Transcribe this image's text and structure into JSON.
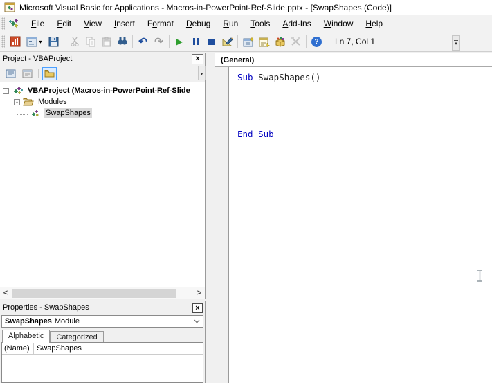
{
  "title_bar": {
    "title": "Microsoft Visual Basic for Applications - Macros-in-PowerPoint-Ref-Slide.pptx - [SwapShapes (Code)]"
  },
  "menu_bar": {
    "items": [
      "File",
      "Edit",
      "View",
      "Insert",
      "Format",
      "Debug",
      "Run",
      "Tools",
      "Add-Ins",
      "Window",
      "Help"
    ]
  },
  "toolbar": {
    "status_text": "Ln 7, Col 1",
    "buttons": [
      {
        "icon": "powerpoint-host-icon",
        "enabled": true
      },
      {
        "icon": "insert-userform-icon",
        "enabled": true
      },
      {
        "icon": "save-icon",
        "enabled": true
      },
      {
        "icon": "cut-icon",
        "enabled": false
      },
      {
        "icon": "copy-icon",
        "enabled": false
      },
      {
        "icon": "paste-icon",
        "enabled": false
      },
      {
        "icon": "find-icon",
        "enabled": true
      },
      {
        "icon": "undo-icon",
        "enabled": true
      },
      {
        "icon": "redo-icon",
        "enabled": false
      },
      {
        "icon": "run-icon",
        "enabled": true
      },
      {
        "icon": "break-icon",
        "enabled": true
      },
      {
        "icon": "reset-icon",
        "enabled": true
      },
      {
        "icon": "design-mode-icon",
        "enabled": true
      },
      {
        "icon": "project-explorer-icon",
        "enabled": true
      },
      {
        "icon": "properties-window-icon",
        "enabled": true
      },
      {
        "icon": "object-browser-icon",
        "enabled": true
      },
      {
        "icon": "toolbox-icon",
        "enabled": false
      },
      {
        "icon": "help-icon",
        "enabled": true
      }
    ]
  },
  "glyphs": {
    "close": "×",
    "dropdown_caret": "▾",
    "undo": "↶",
    "redo": "↷",
    "run": "▶",
    "help": "?",
    "expander_collapse": "-",
    "scroll_left": "<",
    "scroll_right": ">",
    "combo_caret": "▾"
  },
  "project_panel": {
    "title": "Project - VBAProject",
    "tree": {
      "nodes": [
        {
          "icon": "vba-project-icon",
          "label": "VBAProject (Macros-in-PowerPoint-Ref-Slide",
          "bold": true,
          "expanded": true
        },
        {
          "icon": "folder-open-icon",
          "label": "Modules",
          "expanded": true
        },
        {
          "icon": "module-icon",
          "label": "SwapShapes",
          "selected": true
        }
      ]
    }
  },
  "properties_panel": {
    "title": "Properties - SwapShapes",
    "selected_object": "SwapShapes",
    "selected_object_type": "Module",
    "tabs": [
      {
        "label": "Alphabetic",
        "active": true
      },
      {
        "label": "Categorized",
        "active": false
      }
    ],
    "grid": {
      "rows": [
        {
          "property": "(Name)",
          "value": "SwapShapes"
        }
      ]
    }
  },
  "code_panel": {
    "object_dropdown": "(General)",
    "code": {
      "line1_keyword": "Sub",
      "line1_rest": " SwapShapes()",
      "line6": "End Sub"
    }
  },
  "colors": {
    "keyword_blue": "#0000c0",
    "identifier": "#1f1f1f",
    "selection_gray": "#d9d9d9",
    "toolbar_bg": "#f2f2f2",
    "run_green": "#2e9e2e",
    "accent_blue": "#1f4e9e"
  }
}
